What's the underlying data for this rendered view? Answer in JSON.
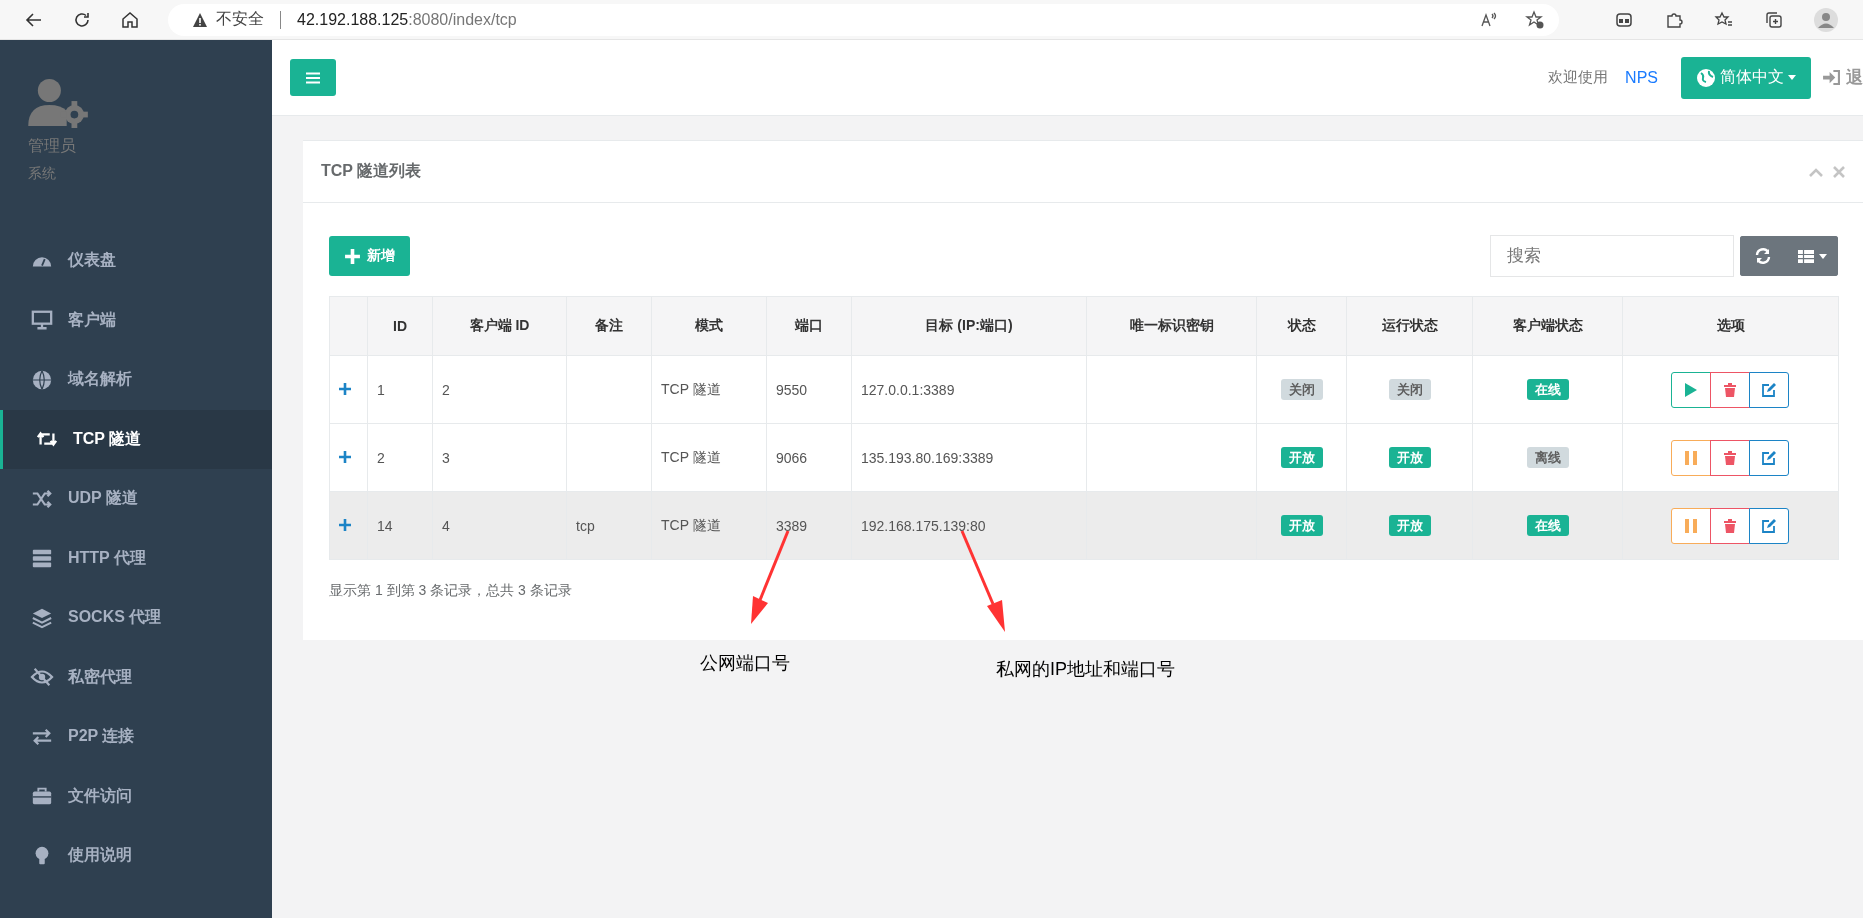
{
  "browser": {
    "security_label": "不安全",
    "url_host": "42.192.188.125",
    "url_rest": ":8080/index/tcp"
  },
  "sidebar": {
    "user_name": "管理员",
    "user_role": "系统",
    "items": [
      {
        "label": "仪表盘",
        "selected": false
      },
      {
        "label": "客户端",
        "selected": false
      },
      {
        "label": "域名解析",
        "selected": false
      },
      {
        "label": "TCP 隧道",
        "selected": true
      },
      {
        "label": "UDP 隧道",
        "selected": false
      },
      {
        "label": "HTTP 代理",
        "selected": false
      },
      {
        "label": "SOCKS 代理",
        "selected": false
      },
      {
        "label": "私密代理",
        "selected": false
      },
      {
        "label": "P2P 连接",
        "selected": false
      },
      {
        "label": "文件访问",
        "selected": false
      },
      {
        "label": "使用说明",
        "selected": false
      }
    ]
  },
  "header": {
    "welcome": "欢迎使用",
    "brand_link": "NPS",
    "language_button": "简体中文",
    "logout_label": "退"
  },
  "panel": {
    "title": "TCP 隧道列表",
    "add_button": "新增",
    "search": {
      "placeholder": "搜索"
    },
    "columns": [
      "ID",
      "客户端 ID",
      "备注",
      "模式",
      "端口",
      "目标 (IP:端口)",
      "唯一标识密钥",
      "状态",
      "运行状态",
      "客户端状态",
      "选项"
    ],
    "rows": [
      {
        "id": "1",
        "client_id": "2",
        "mode": "TCP 隧道",
        "port": "9550",
        "target": "127.0.0.1:3389",
        "status": {
          "label": "关闭",
          "on": false
        },
        "run_status": {
          "label": "关闭",
          "on": false
        },
        "client_status": {
          "label": "在线",
          "on": true
        },
        "running": false,
        "selected": false
      },
      {
        "id": "2",
        "client_id": "3",
        "mode": "TCP 隧道",
        "port": "9066",
        "target": "135.193.80.169:3389",
        "status": {
          "label": "开放",
          "on": true
        },
        "run_status": {
          "label": "开放",
          "on": true
        },
        "client_status": {
          "label": "离线",
          "on": false
        },
        "running": true,
        "selected": false
      },
      {
        "id": "14",
        "client_id": "4",
        "remark": "tcp",
        "mode": "TCP 隧道",
        "port": "3389",
        "target": "192.168.175.139:80",
        "status": {
          "label": "开放",
          "on": true
        },
        "run_status": {
          "label": "开放",
          "on": true
        },
        "client_status": {
          "label": "在线",
          "on": true
        },
        "running": true,
        "selected": true
      }
    ],
    "footer": "显示第 1 到第 3 条记录，总共 3 条记录"
  },
  "annotations": [
    {
      "text": "公网端口号"
    },
    {
      "text": "私网的IP地址和端口号"
    }
  ]
}
